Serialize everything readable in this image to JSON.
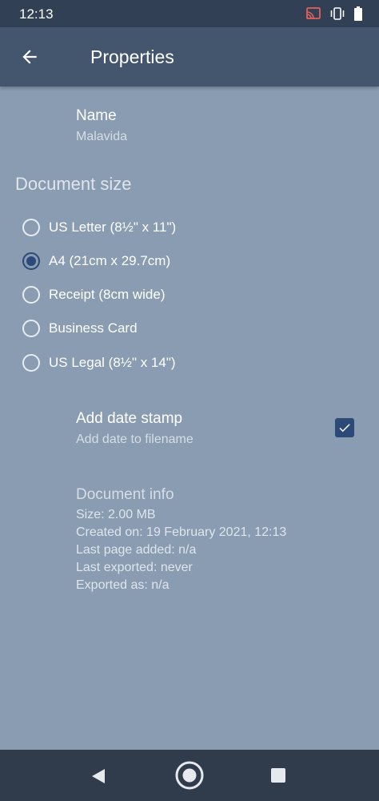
{
  "status_bar": {
    "time": "12:13",
    "icons": [
      "cast-icon",
      "vibrate-icon",
      "battery-icon"
    ]
  },
  "app_bar": {
    "title": "Properties",
    "back_icon": "arrow-back-icon"
  },
  "name": {
    "label": "Name",
    "value": "Malavida"
  },
  "document_size": {
    "title": "Document size",
    "options": [
      {
        "label": "US Letter (8½\" x 11\")",
        "selected": false
      },
      {
        "label": "A4 (21cm x 29.7cm)",
        "selected": true
      },
      {
        "label": "Receipt (8cm wide)",
        "selected": false
      },
      {
        "label": "Business Card",
        "selected": false
      },
      {
        "label": "US Legal (8½\" x 14\")",
        "selected": false
      }
    ]
  },
  "date_stamp": {
    "title": "Add date stamp",
    "subtitle": "Add date to filename",
    "checked": true
  },
  "document_info": {
    "title": "Document info",
    "lines": [
      "Size: 2.00 MB",
      "Created on: 19 February 2021, 12:13",
      "Last page added: n/a",
      "Last exported: never",
      "Exported as: n/a"
    ]
  },
  "colors": {
    "background": "#8a9cb2",
    "app_bar": "#44566e",
    "accent": "#2c4a78"
  },
  "nav_bar": {
    "icons": [
      "nav-back-icon",
      "nav-home-icon",
      "nav-recents-icon"
    ]
  }
}
